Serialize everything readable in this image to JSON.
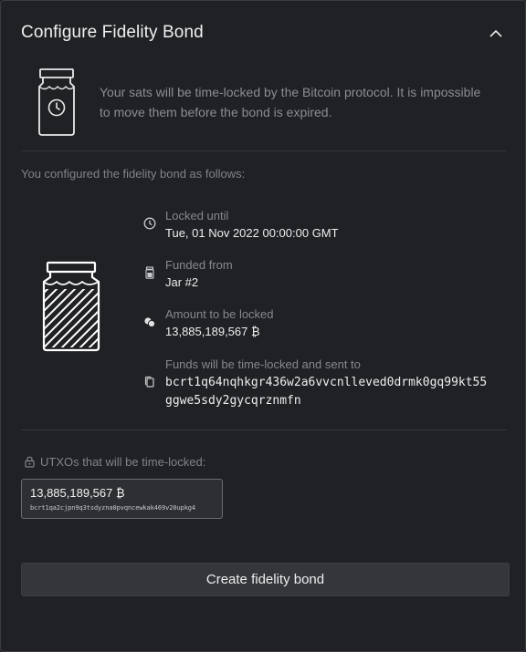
{
  "header": {
    "title": "Configure Fidelity Bond"
  },
  "intro": {
    "text": "Your sats will be time-locked by the Bitcoin protocol. It is impossible to move them before the bond is expired."
  },
  "summary": {
    "heading": "You configured the fidelity bond as follows:"
  },
  "details": {
    "locked_until": {
      "label": "Locked until",
      "value": "Tue, 01 Nov 2022 00:00:00 GMT"
    },
    "funded_from": {
      "label": "Funded from",
      "value": "Jar #2"
    },
    "amount": {
      "label": "Amount to be locked",
      "value": "13,885,189,567 ₿"
    },
    "destination": {
      "label": "Funds will be time-locked and sent to",
      "line1": "bcrt1q64nqhkgr436w2a6vvcnlleved0drmk0gq99kt55",
      "line2": "ggwe5sdy2gycqrznmfn"
    }
  },
  "utxos": {
    "heading": "UTXOs that will be time-locked:",
    "items": [
      {
        "amount": "13,885,189,567 ₿",
        "address": "bcrt1qa2cjpn9q3tsdyzna0pvqncewkak469v20upkg4"
      }
    ]
  },
  "actions": {
    "create_label": "Create fidelity bond"
  },
  "icons": {
    "collapse": "chevron-up-icon",
    "intro": "jar-clock-icon",
    "jar": "filled-jar-icon",
    "locked_until": "clock-icon",
    "funded_from": "jar-small-icon",
    "amount": "coins-icon",
    "destination": "copy-icon",
    "utxo": "lock-icon"
  },
  "colors": {
    "background": "#202124",
    "text": "#e8e9ea",
    "muted": "#85888d",
    "button": "#34363a"
  }
}
